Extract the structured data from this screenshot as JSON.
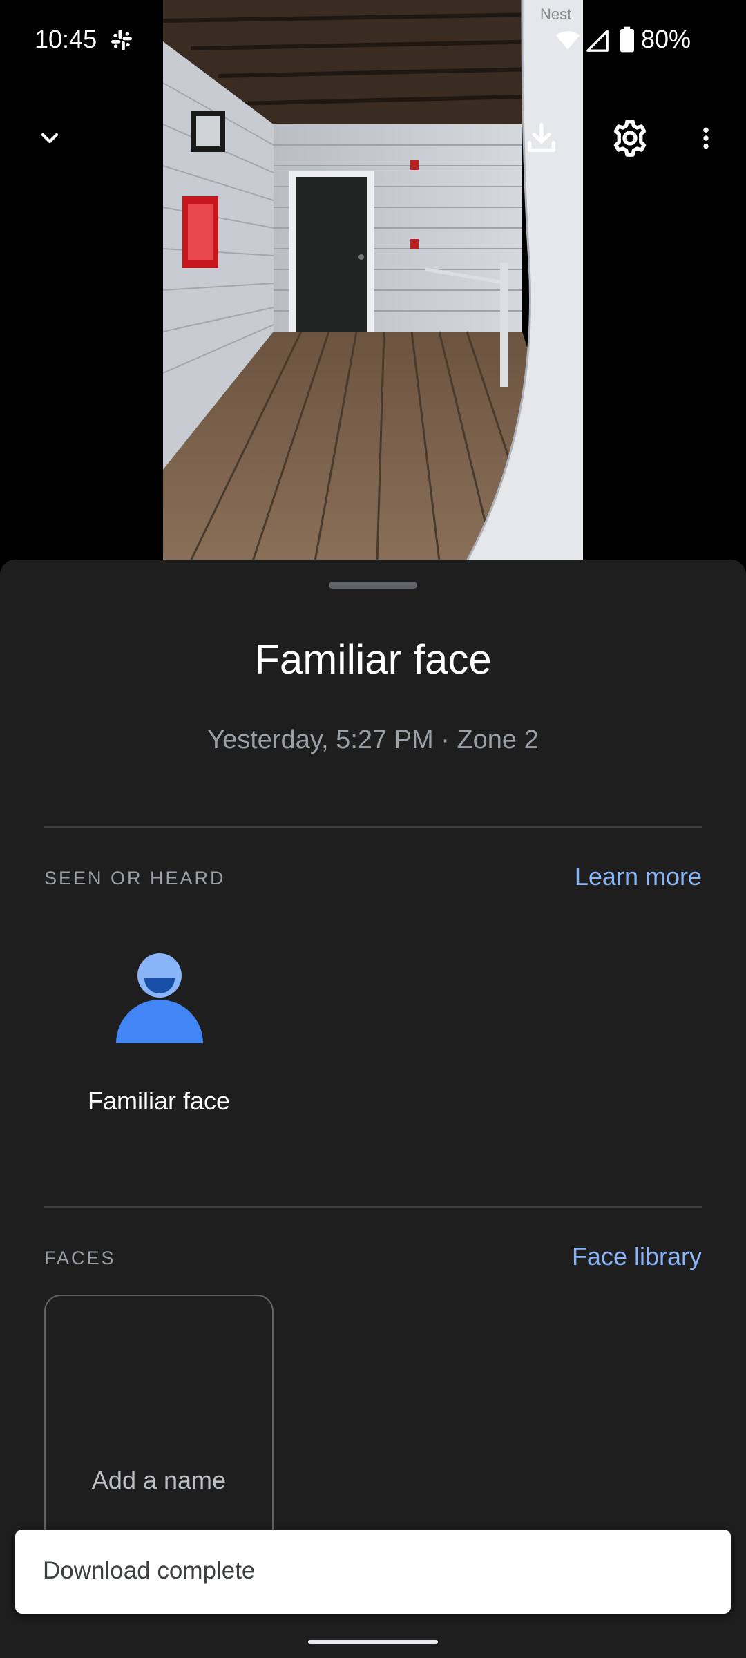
{
  "status_bar": {
    "time": "10:45",
    "battery": "80%",
    "icons": [
      "slack-icon",
      "wifi-icon",
      "signal-icon",
      "battery-icon"
    ]
  },
  "camera": {
    "brand_label": "Nest",
    "controls": [
      "chevron-down-icon",
      "download-icon",
      "gear-icon",
      "more-vert-icon"
    ]
  },
  "sheet": {
    "title": "Familiar face",
    "subtitle": "Yesterday, 5:27 PM · Zone 2",
    "seen_section": {
      "label": "SEEN OR HEARD",
      "link": "Learn more",
      "item_label": "Familiar face",
      "item_icon": "familiar-face-icon"
    },
    "faces_section": {
      "label": "FACES",
      "link": "Face library",
      "card_label": "Add a name"
    }
  },
  "snackbar": {
    "text": "Download complete"
  },
  "colors": {
    "sheet_bg": "#1e1e1f",
    "accent_link": "#8ab4f8",
    "person_blue": "#4285f4",
    "person_head": "#8ab4f8"
  }
}
